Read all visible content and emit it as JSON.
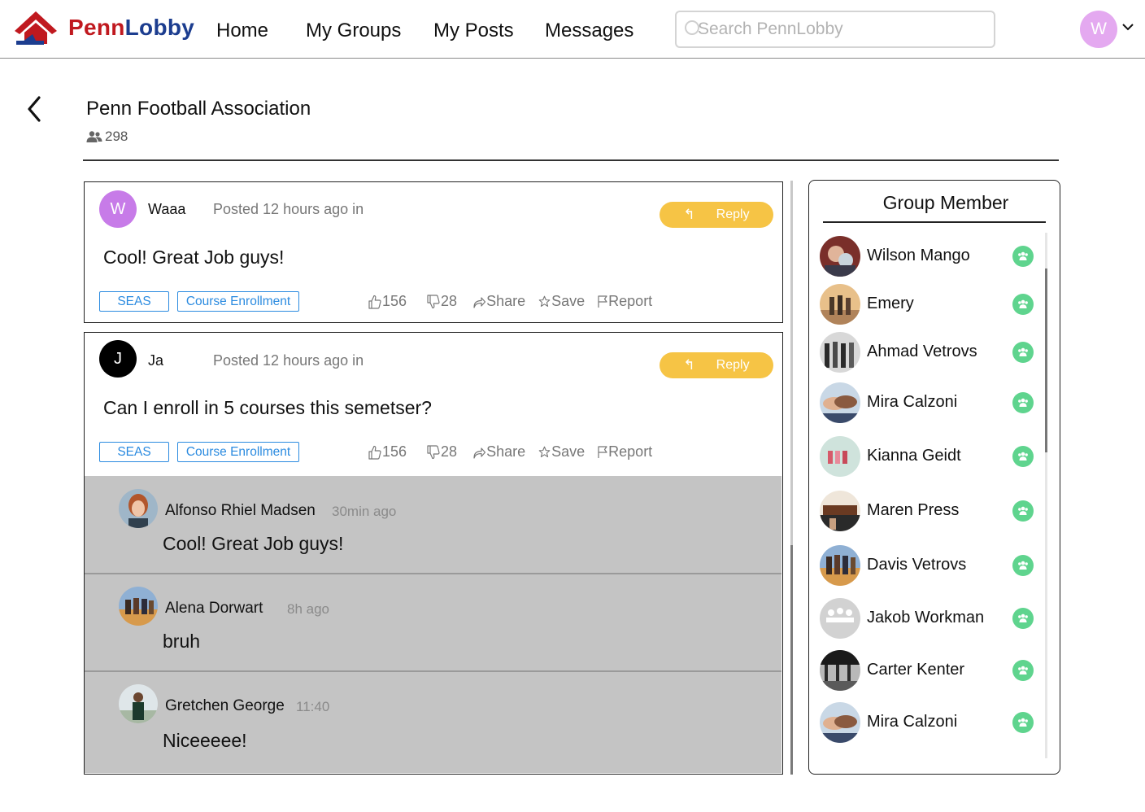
{
  "brand": {
    "part1": "Penn",
    "part2": "Lobby"
  },
  "nav": {
    "home": "Home",
    "groups": "My Groups",
    "posts": "My Posts",
    "messages": "Messages"
  },
  "search": {
    "placeholder": "Search PennLobby"
  },
  "user": {
    "initial": "W"
  },
  "group": {
    "name": "Penn Football Association",
    "member_count": "298"
  },
  "posts": [
    {
      "avatar_initial": "W",
      "author": "Waaa",
      "meta": "Posted 12 hours ago in",
      "reply_label": "Reply",
      "body": "Cool! Great Job guys!",
      "tags": [
        "SEAS",
        "Course Enrollment"
      ],
      "likes": "156",
      "dislikes": "28",
      "share": "Share",
      "save": "Save",
      "report": "Report"
    },
    {
      "avatar_initial": "J",
      "author": "Ja",
      "meta": "Posted 12 hours ago in",
      "reply_label": "Reply",
      "body": "Can I enroll in 5 courses this semetser?",
      "tags": [
        "SEAS",
        "Course Enrollment"
      ],
      "likes": "156",
      "dislikes": "28",
      "share": "Share",
      "save": "Save",
      "report": "Report"
    }
  ],
  "comments": [
    {
      "name": "Alfonso Rhiel Madsen",
      "time": "30min ago",
      "text": "Cool! Great Job guys!"
    },
    {
      "name": "Alena Dorwart",
      "time": "8h ago",
      "text": "bruh"
    },
    {
      "name": "Gretchen George",
      "time": "11:40",
      "text": "Niceeeee!"
    }
  ],
  "members_panel": {
    "title": "Group Member",
    "members": [
      {
        "name": "Wilson Mango"
      },
      {
        "name": "Emery"
      },
      {
        "name": "Ahmad Vetrovs"
      },
      {
        "name": "Mira Calzoni"
      },
      {
        "name": "Kianna Geidt"
      },
      {
        "name": "Maren Press"
      },
      {
        "name": "Davis Vetrovs"
      },
      {
        "name": "Jakob Workman"
      },
      {
        "name": "Carter Kenter"
      },
      {
        "name": "Mira Calzoni"
      }
    ]
  },
  "colors": {
    "brand_red": "#c0191f",
    "brand_blue": "#1c3d8f",
    "reply_yellow": "#f6c445",
    "tag_blue": "#2b8be0",
    "member_badge_green": "#5fd48e",
    "user_avatar": "#e4a9f0",
    "post1_avatar": "#c77be8",
    "post2_avatar": "#000000",
    "comments_bg": "#c4c4c4"
  },
  "icons": {
    "like": "thumbs-up-icon",
    "dislike": "thumbs-down-icon",
    "share": "share-icon",
    "save": "star-icon",
    "report": "flag-icon",
    "reply": "reply-arrow-icon",
    "back": "chevron-left-icon",
    "member_badge": "group-icon"
  }
}
